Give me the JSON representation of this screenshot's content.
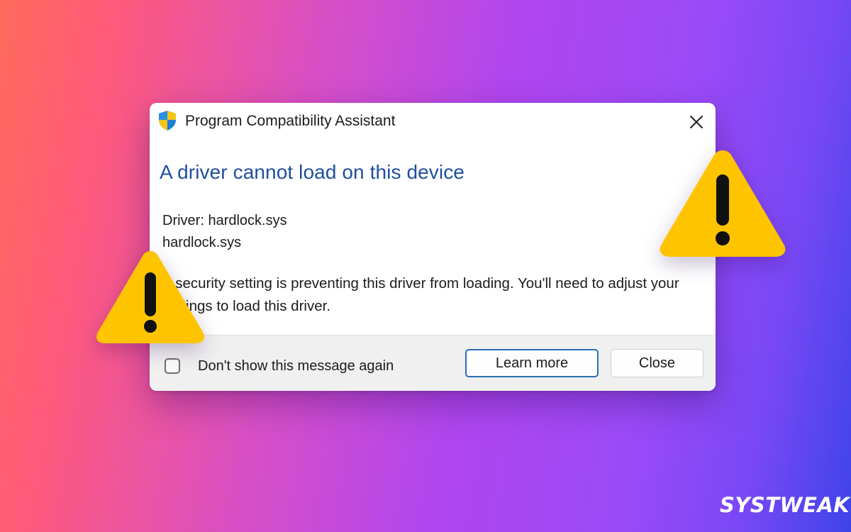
{
  "dialog": {
    "title": "Program Compatibility Assistant",
    "heading": "A driver cannot load on this device",
    "driver_label": "Driver: hardlock.sys",
    "driver_name": "hardlock.sys",
    "message": "A security setting is preventing this driver from loading. You'll need to adjust your settings to load this driver.",
    "checkbox_label": "Don't show this message again",
    "checkbox_checked": false,
    "learn_more_label": "Learn more",
    "close_label": "Close",
    "close_icon": "close-icon",
    "title_icon": "windows-security-shield-icon"
  },
  "decorations": {
    "warning_icon": "warning-triangle-icon",
    "warning_color": "#FFC400"
  },
  "brand": {
    "logo_text": "SYSTWEAK"
  },
  "colors": {
    "heading": "#1F4E9E",
    "primary_button_border": "#2B6FB6"
  }
}
